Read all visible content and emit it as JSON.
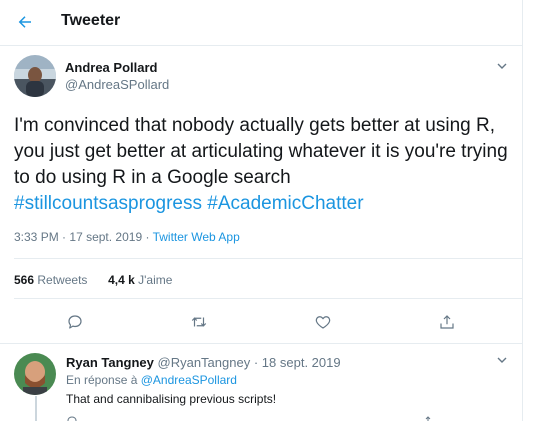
{
  "header": {
    "title": "Tweeter"
  },
  "tweet": {
    "author": {
      "name": "Andrea Pollard",
      "handle": "@AndreaSPollard"
    },
    "text_plain": "I'm convinced that nobody actually gets better at using R, you just get better at articulating whatever it is you're trying to do using R in a Google search",
    "hashtags": [
      "#stillcountsasprogress",
      "#AcademicChatter"
    ],
    "time": "3:33 PM",
    "date": "17 sept. 2019",
    "source": "Twitter Web App",
    "stats": {
      "retweets_count": "566",
      "retweets_label": "Retweets",
      "likes_count": "4,4 k",
      "likes_label": "J'aime"
    },
    "actions": [
      "reply-icon",
      "retweet-icon",
      "like-icon",
      "share-icon"
    ]
  },
  "reply": {
    "name": "Ryan Tangney",
    "handle": "@RyanTangney",
    "date": "18 sept. 2019",
    "replying_prefix": "En réponse à",
    "replying_to": "@AndreaSPollard",
    "text": "That and cannibalising previous scripts!"
  },
  "colors": {
    "accent": "#1b95e0",
    "muted": "#657786",
    "text": "#14171a",
    "border": "#e6ecf0"
  }
}
